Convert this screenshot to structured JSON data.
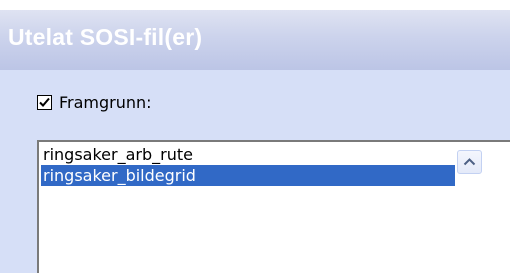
{
  "window": {
    "title": "Utelat SOSI-fil(er)"
  },
  "framgrunn": {
    "label": "Framgrunn:",
    "checked": true
  },
  "list": {
    "items": [
      {
        "label": "ringsaker_arb_rute",
        "selected": false
      },
      {
        "label": "ringsaker_bildegrid",
        "selected": true
      }
    ]
  },
  "colors": {
    "title_bar": "#c7cfea",
    "panel": "#d6dff7",
    "selection": "#3169c6"
  },
  "icons": {
    "checkbox": "check-icon",
    "scroll_up": "chevron-up-icon"
  }
}
